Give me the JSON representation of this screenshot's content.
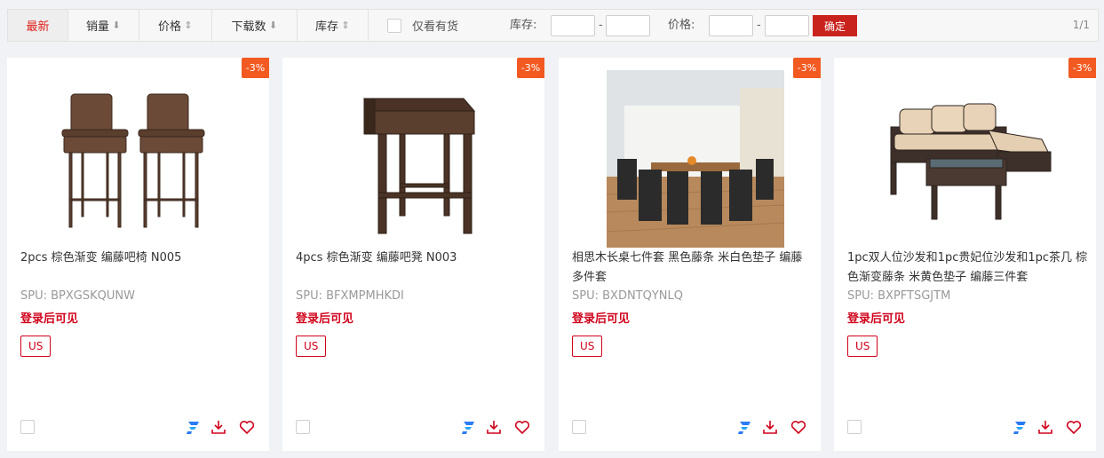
{
  "toolbar": {
    "sort_tabs": [
      {
        "label": "最新",
        "icon": ""
      },
      {
        "label": "销量",
        "icon": "⬇"
      },
      {
        "label": "价格",
        "icon": "⇕"
      },
      {
        "label": "下载数",
        "icon": "⬇"
      },
      {
        "label": "库存",
        "icon": "⇕"
      }
    ],
    "only_in_stock_label": "仅看有货",
    "stock_label": "库存:",
    "price_label": "价格:",
    "range_dash": "-",
    "confirm_label": "确定",
    "page_count": "1/1"
  },
  "colors": {
    "accent_red": "#c9231e",
    "badge_orange": "#f25a22",
    "login_red": "#d0021b",
    "brand_blue": "#2a7bf5"
  },
  "products": [
    {
      "discount": "-3%",
      "title": "2pcs 棕色渐变 编藤吧椅 N005",
      "spu": "SPU:  BPXGSKQUNW",
      "login_text": "登录后可见",
      "region": "US"
    },
    {
      "discount": "-3%",
      "title": "4pcs 棕色渐变 编藤吧凳 N003",
      "spu": "SPU:  BFXMPMHKDI",
      "login_text": "登录后可见",
      "region": "US"
    },
    {
      "discount": "-3%",
      "title": "相思木长桌七件套 黑色藤条 米白色垫子 编藤多件套",
      "spu": "SPU:  BXDNTQYNLQ",
      "login_text": "登录后可见",
      "region": "US"
    },
    {
      "discount": "-3%",
      "title": "1pc双人位沙发和1pc贵妃位沙发和1pc茶几 棕色渐变藤条 米黄色垫子 编藤三件套",
      "spu": "SPU:  BXPFTSGJTM",
      "login_text": "登录后可见",
      "region": "US"
    }
  ]
}
